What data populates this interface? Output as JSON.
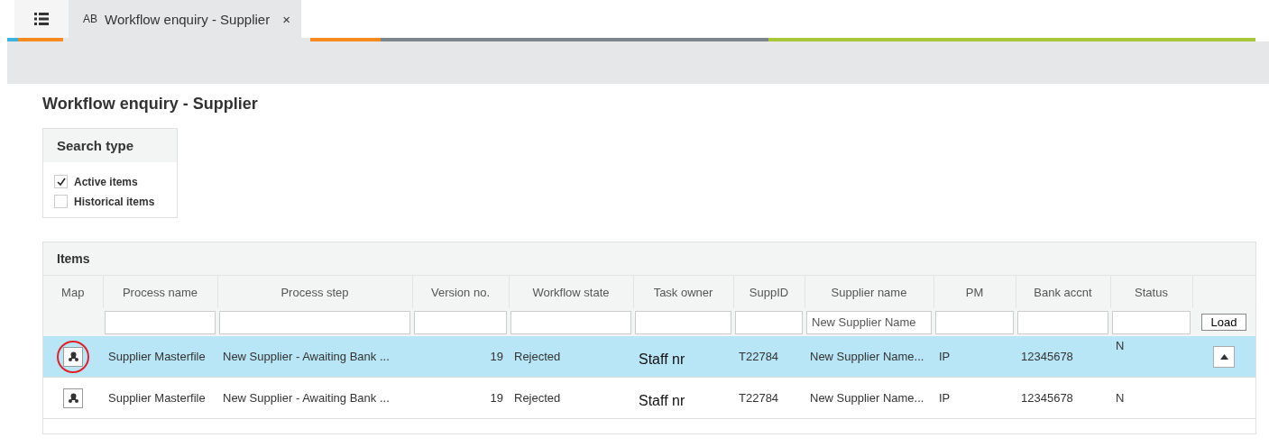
{
  "tabs": [
    {
      "kind": "menu",
      "selected": false
    },
    {
      "kind": "page",
      "badge": "AB",
      "label": "Workflow enquiry - Supplier",
      "close": "×",
      "selected": true
    }
  ],
  "title": "Workflow enquiry - Supplier",
  "search_type": {
    "heading": "Search type",
    "options": [
      {
        "label": "Active items",
        "checked": true
      },
      {
        "label": "Historical items",
        "checked": false
      }
    ]
  },
  "items": {
    "heading": "Items",
    "columns": [
      "Map",
      "Process name",
      "Process step",
      "Version no.",
      "Workflow state",
      "Task owner",
      "SuppID",
      "Supplier name",
      "PM",
      "Bank accnt",
      "Status"
    ],
    "supplier_name_filter": "New Supplier Name",
    "load_button": "Load",
    "rows": [
      {
        "selected": true,
        "circled": true,
        "collapse_button": true,
        "cells": [
          "",
          "Supplier Masterfile",
          "New Supplier - Awaiting Bank ...",
          "19",
          "Rejected",
          "Staff nr",
          "T22784",
          "New Supplier Name...",
          "IP",
          "12345678",
          "N"
        ]
      },
      {
        "selected": false,
        "circled": false,
        "collapse_button": false,
        "cells": [
          "",
          "Supplier Masterfile",
          "New Supplier - Awaiting Bank ...",
          "19",
          "Rejected",
          "Staff nr",
          "T22784",
          "New Supplier Name...",
          "IP",
          "12345678",
          "N"
        ]
      }
    ]
  }
}
